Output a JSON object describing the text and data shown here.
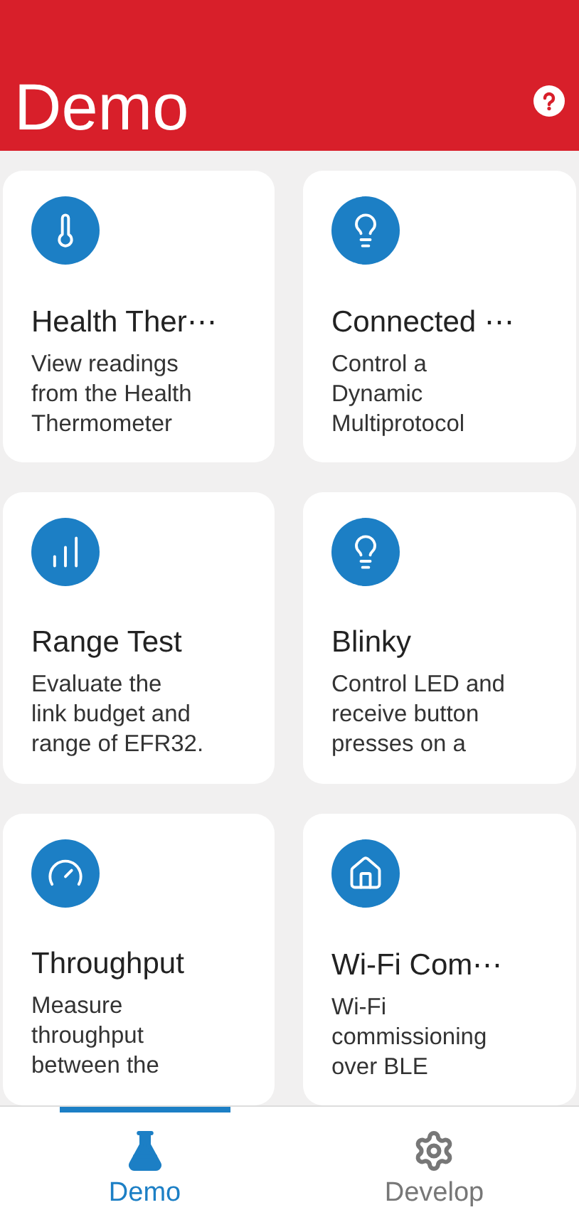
{
  "header": {
    "title": "Demo"
  },
  "cards": [
    {
      "kind": "thermometer",
      "title": "Health Ther⋯",
      "description": [
        "View readings",
        "from the Health",
        "Thermometer"
      ]
    },
    {
      "kind": "bulb",
      "title": "Connected ⋯",
      "description": [
        "Control a",
        "Dynamic",
        "Multiprotocol"
      ]
    },
    {
      "kind": "chart",
      "title": "Range Test",
      "description": [
        "Evaluate the",
        "link budget and",
        "range of EFR32."
      ]
    },
    {
      "kind": "bulb",
      "title": "Blinky",
      "description": [
        "Control LED and",
        "receive button",
        "presses on a"
      ]
    },
    {
      "kind": "gauge",
      "title": "Throughput",
      "description": [
        "Measure",
        "throughput",
        "between the"
      ]
    },
    {
      "kind": "house",
      "title": "Wi-Fi Com⋯",
      "description": [
        "Wi-Fi",
        "commissioning",
        "over BLE"
      ]
    }
  ],
  "tabs": [
    {
      "kind": "flask",
      "label": "Demo",
      "selected": true
    },
    {
      "kind": "gear",
      "label": "Develop",
      "selected": false
    }
  ]
}
